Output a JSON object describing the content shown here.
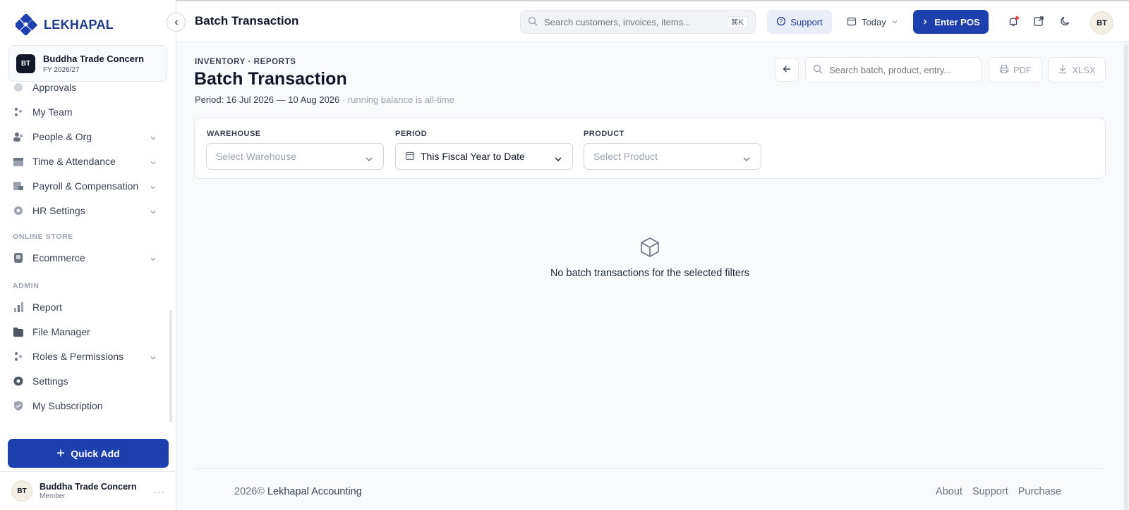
{
  "brand": {
    "name": "LEKHAPAL",
    "color": "#1e40af"
  },
  "organization": {
    "initials": "BT",
    "name": "Buddha Trade Concern",
    "fiscal_year": "FY 2026/27"
  },
  "sidebar": {
    "partial_item": "Approvals",
    "items": [
      {
        "label": "My Team",
        "icon": "team-icon",
        "expandable": false
      },
      {
        "label": "People & Org",
        "icon": "people-icon",
        "expandable": true
      },
      {
        "label": "Time & Attendance",
        "icon": "calendar-icon",
        "expandable": true
      },
      {
        "label": "Payroll & Compensation",
        "icon": "payroll-icon",
        "expandable": true
      },
      {
        "label": "HR Settings",
        "icon": "gear-icon",
        "expandable": true
      }
    ],
    "sections": [
      {
        "title": "ONLINE STORE",
        "items": [
          {
            "label": "Ecommerce",
            "icon": "store-icon",
            "expandable": true
          }
        ]
      },
      {
        "title": "ADMIN",
        "items": [
          {
            "label": "Report",
            "icon": "bar-chart-icon",
            "expandable": false
          },
          {
            "label": "File Manager",
            "icon": "folder-icon",
            "expandable": false
          },
          {
            "label": "Roles & Permissions",
            "icon": "roles-icon",
            "expandable": true
          },
          {
            "label": "Settings",
            "icon": "settings-icon",
            "expandable": false
          },
          {
            "label": "My Subscription",
            "icon": "shield-icon",
            "expandable": false
          }
        ]
      }
    ],
    "quick_add_label": "Quick Add"
  },
  "user": {
    "initials": "BT",
    "name": "Buddha Trade Concern",
    "role": "Member"
  },
  "topbar": {
    "title": "Batch Transaction",
    "search_placeholder": "Search customers, invoices, items...",
    "shortcut": "⌘K",
    "support_label": "Support",
    "date_label": "Today",
    "pos_label": "Enter POS",
    "avatar_initials": "BT"
  },
  "page": {
    "breadcrumb": "INVENTORY · REPORTS",
    "title": "Batch Transaction",
    "period_text": "Period: 16 Jul 2026 — 10 Aug 2026",
    "period_note": " · running balance is all-time",
    "search_placeholder": "Search batch, product, entry...",
    "pdf_label": "PDF",
    "xlsx_label": "XLSX"
  },
  "filters": {
    "warehouse": {
      "label": "WAREHOUSE",
      "placeholder": "Select Warehouse"
    },
    "period": {
      "label": "PERIOD",
      "value": "This Fiscal Year to Date"
    },
    "product": {
      "label": "PRODUCT",
      "placeholder": "Select Product"
    }
  },
  "empty_state": {
    "icon": "box-icon",
    "message": "No batch transactions for the selected filters"
  },
  "footer": {
    "copyright_year": "2026©",
    "company": " Lekhapal Accounting",
    "links": [
      "About",
      "Support",
      "Purchase"
    ]
  }
}
